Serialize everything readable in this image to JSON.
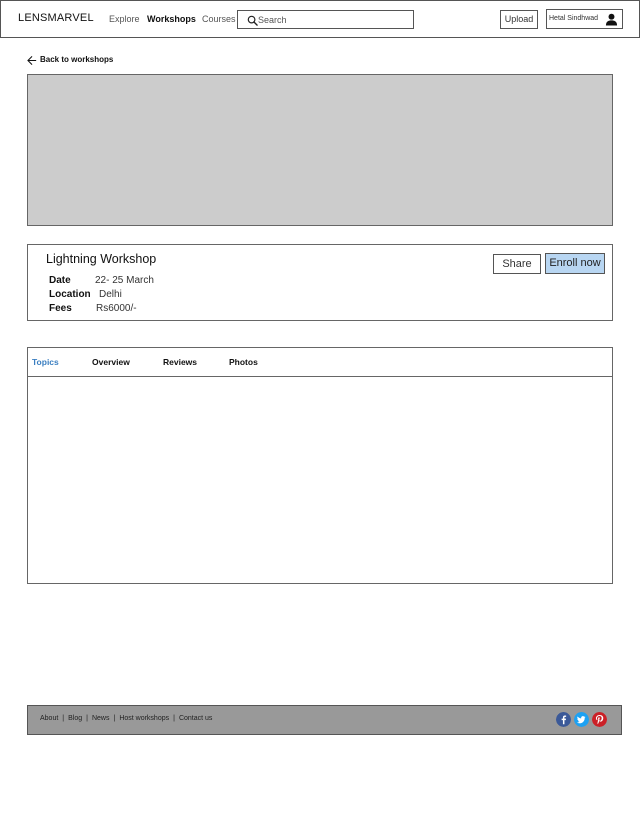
{
  "header": {
    "logo": "LENSMARVEL",
    "nav": [
      {
        "label": "Explore",
        "active": false
      },
      {
        "label": "Workshops",
        "active": true
      },
      {
        "label": "Courses",
        "active": false
      }
    ],
    "search": {
      "placeholder": "Search",
      "value": ""
    },
    "upload_label": "Upload",
    "user_name": "Hetal Sindhwad"
  },
  "back_label": "Back to workshops",
  "workshop": {
    "title": "Lightning Workshop",
    "date_label": "Date",
    "date_value": "22- 25 March",
    "location_label": "Location",
    "location_value": "Delhi",
    "fees_label": "Fees",
    "fees_value": "Rs6000/-",
    "share_label": "Share",
    "enroll_label": "Enroll now"
  },
  "tabs": [
    {
      "label": "Topics",
      "active": true
    },
    {
      "label": "Overview",
      "active": false
    },
    {
      "label": "Reviews",
      "active": false
    },
    {
      "label": "Photos",
      "active": false
    }
  ],
  "footer": {
    "links": [
      "About",
      "Blog",
      "News",
      "Host workshops",
      "Contact us"
    ],
    "social": [
      {
        "icon": "facebook-icon",
        "color": "#3b5998"
      },
      {
        "icon": "twitter-icon",
        "color": "#1da1f2"
      },
      {
        "icon": "pinterest-icon",
        "color": "#cb2027"
      }
    ]
  },
  "colors": {
    "accent": "#3a7ec0",
    "enroll_bg": "#b8d6f2",
    "hero_placeholder": "#cccccc",
    "footer_bg": "#999999"
  }
}
